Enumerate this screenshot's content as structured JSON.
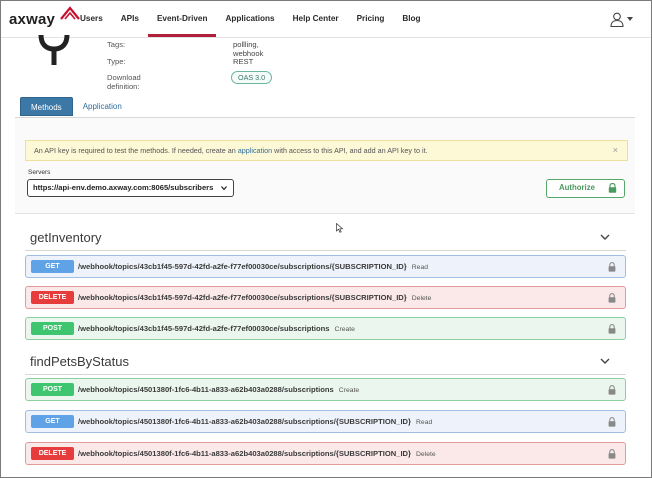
{
  "nav": {
    "logo_text": "axway",
    "items": [
      {
        "label": "Users"
      },
      {
        "label": "APIs"
      },
      {
        "label": "Event-Driven"
      },
      {
        "label": "Applications"
      },
      {
        "label": "Help Center"
      },
      {
        "label": "Pricing"
      },
      {
        "label": "Blog"
      }
    ],
    "active_item": "Event-Driven"
  },
  "details": {
    "tags_label": "Tags:",
    "tags_value": "pollling, webhook",
    "type_label": "Type:",
    "type_value": "REST",
    "download_label": "Download definition:",
    "download_value": "OAS 3.0"
  },
  "tabs": [
    {
      "label": "Methods",
      "active": true
    },
    {
      "label": "Application",
      "active": false
    }
  ],
  "alert": {
    "text_before": "An API key is required to test the methods. If needed, create an",
    "link": "application",
    "text_after": "with access to this API, and add an API key to it.",
    "close": "×"
  },
  "servers": {
    "label": "Servers",
    "selected": "https://api-env.demo.axway.com:8065/subscribers"
  },
  "authorize": {
    "label": "Authorize"
  },
  "groups": [
    {
      "title": "getInventory",
      "operations": [
        {
          "method": "GET",
          "path": "/webhook/topics/43cb1f45-597d-42fd-a2fe-f77ef00030ce/subscriptions/{SUBSCRIPTION_ID}",
          "summary": "Read"
        },
        {
          "method": "DELETE",
          "path": "/webhook/topics/43cb1f45-597d-42fd-a2fe-f77ef00030ce/subscriptions/{SUBSCRIPTION_ID}",
          "summary": "Delete"
        },
        {
          "method": "POST",
          "path": "/webhook/topics/43cb1f45-597d-42fd-a2fe-f77ef00030ce/subscriptions",
          "summary": "Create"
        }
      ]
    },
    {
      "title": "findPetsByStatus",
      "operations": [
        {
          "method": "POST",
          "path": "/webhook/topics/4501380f-1fc6-4b11-a833-a62b403a0288/subscriptions",
          "summary": "Create"
        },
        {
          "method": "GET",
          "path": "/webhook/topics/4501380f-1fc6-4b11-a833-a62b403a0288/subscriptions/{SUBSCRIPTION_ID}",
          "summary": "Read"
        },
        {
          "method": "DELETE",
          "path": "/webhook/topics/4501380f-1fc6-4b11-a833-a62b403a0288/subscriptions/{SUBSCRIPTION_ID}",
          "summary": "Delete"
        }
      ]
    }
  ],
  "colors": {
    "accent": "#b0203a",
    "get": "#5fa3e6",
    "delete": "#e63c3c",
    "post": "#3fc46f"
  },
  "icons": {
    "user": "user-icon",
    "lock": "lock-icon",
    "chevron": "chevron-down-icon",
    "close": "close-icon"
  }
}
